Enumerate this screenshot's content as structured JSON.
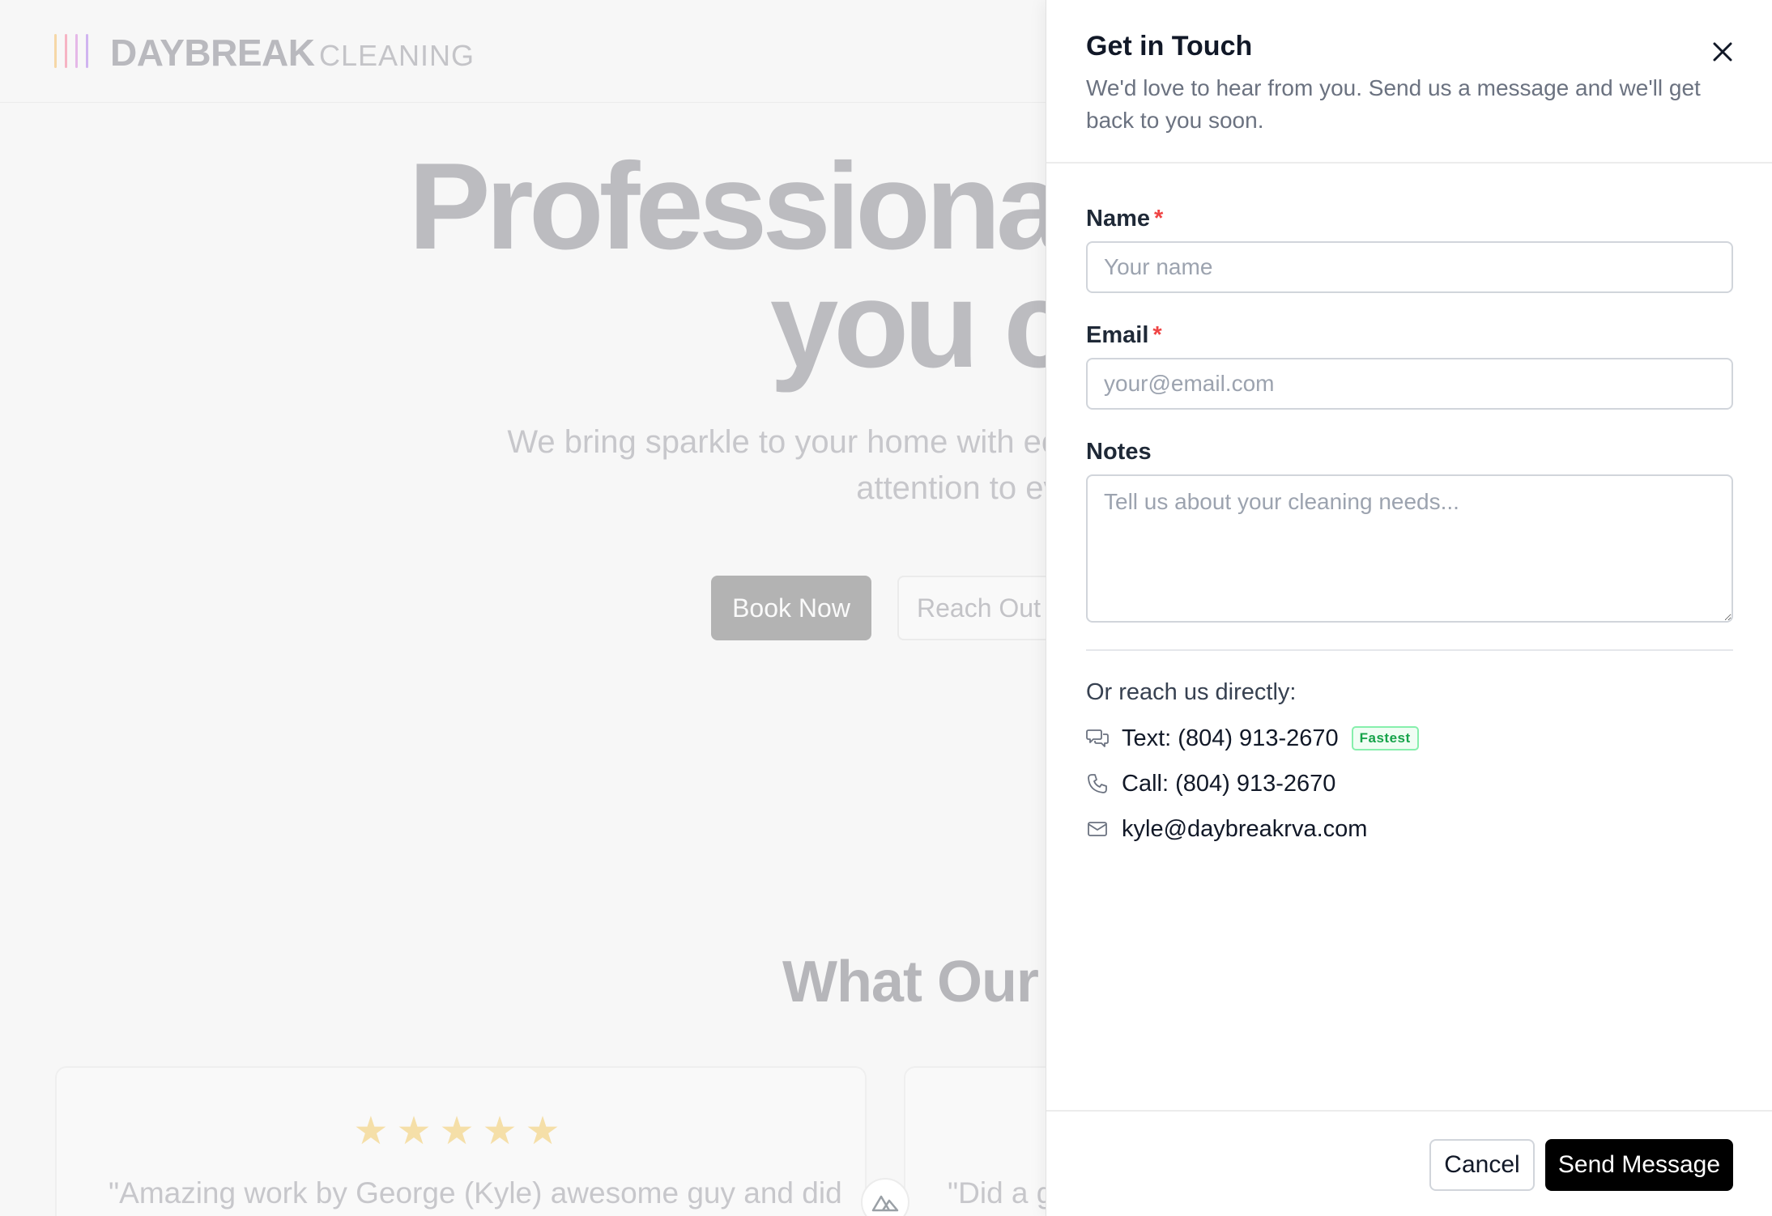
{
  "site": {
    "logo_word": "DAYBREAK",
    "logo_sub": "CLEANING",
    "logo_bar_colors": [
      "#f6d7a7",
      "#f6b4c4",
      "#e5b8e8",
      "#d0b4f0"
    ],
    "hero": {
      "title_line1": "Professional hom",
      "title_line2": "you can tr",
      "subtitle_line1": "We bring sparkle to your home with eco-friendly prod",
      "subtitle_line2": "attention to every detail"
    },
    "buttons": {
      "book": "Book Now",
      "reach": "Reach Out"
    },
    "testimonials": {
      "title": "What Our Custome",
      "cards": [
        {
          "stars": "★★★★★",
          "text": "\"Amazing work by George (Kyle) awesome guy and did"
        },
        {
          "stars": "",
          "text": "\"Did a g"
        }
      ]
    }
  },
  "drawer": {
    "title": "Get in Touch",
    "description": "We'd love to hear from you. Send us a message and we'll get back to you soon.",
    "fields": {
      "name": {
        "label": "Name",
        "required_mark": "*",
        "placeholder": "Your name",
        "value": ""
      },
      "email": {
        "label": "Email",
        "required_mark": "*",
        "placeholder": "your@email.com",
        "value": ""
      },
      "notes": {
        "label": "Notes",
        "placeholder": "Tell us about your cleaning needs...",
        "value": ""
      }
    },
    "direct": {
      "heading": "Or reach us directly:",
      "text": {
        "label": "Text: (804) 913-2670",
        "badge": "Fastest",
        "icon": "chat-icon"
      },
      "call": {
        "label": "Call: (804) 913-2670",
        "icon": "phone-icon"
      },
      "email": {
        "label": "kyle@daybreakrva.com",
        "icon": "mail-icon"
      }
    },
    "footer": {
      "cancel": "Cancel",
      "send": "Send Message"
    }
  },
  "colors": {
    "accent": "#000000",
    "required": "#ef4444",
    "badge_green": "#16a34a"
  }
}
